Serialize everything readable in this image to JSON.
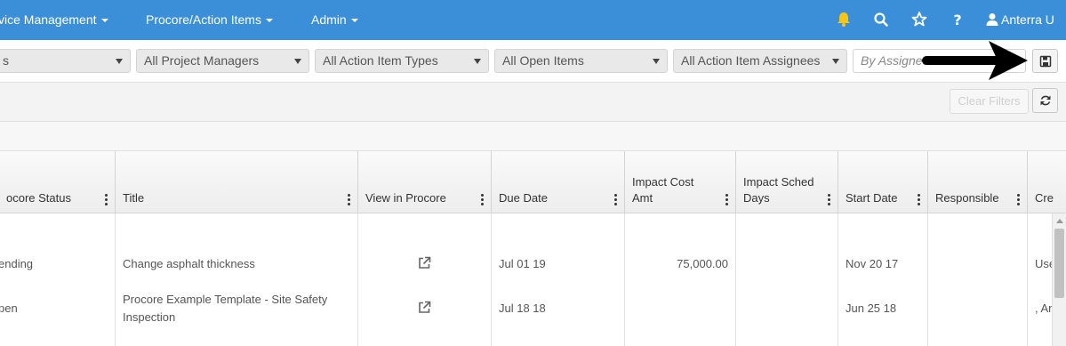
{
  "nav": {
    "items": [
      {
        "label": "vice Management"
      },
      {
        "label": "Procore/Action Items"
      },
      {
        "label": "Admin"
      }
    ],
    "user_label": "Anterra U"
  },
  "filters": {
    "f0": "s",
    "project_managers": "All Project Managers",
    "action_item_types": "All Action Item Types",
    "open_items": "All Open Items",
    "action_item_assignees": "All Action Item Assignees",
    "group_by": "By Assignee"
  },
  "toolbar": {
    "clear_filters": "Clear Filters"
  },
  "grid": {
    "columns": [
      {
        "label": "ocore Status"
      },
      {
        "label": "Title"
      },
      {
        "label": "View in Procore"
      },
      {
        "label": "Due Date"
      },
      {
        "label": "Impact Cost\nAmt"
      },
      {
        "label": "Impact Sched\nDays"
      },
      {
        "label": "Start Date"
      },
      {
        "label": "Responsible"
      },
      {
        "label": "Cre"
      }
    ],
    "rows": [
      {
        "status": "ending",
        "title": "Change asphalt thickness",
        "due_date": "Jul 01 19",
        "impact_cost": "75,000.00",
        "impact_days": "",
        "start_date": "Nov 20 17",
        "responsible": "",
        "created": "Use"
      },
      {
        "status": "pen",
        "title": "Procore Example Template - Site Safety Inspection",
        "due_date": "Jul 18 18",
        "impact_cost": "",
        "impact_days": "",
        "start_date": "Jun 25 18",
        "responsible": "",
        "created": ", An"
      }
    ]
  },
  "colors": {
    "nav_bg": "#3b8fd9",
    "bell": "#f5c518"
  }
}
